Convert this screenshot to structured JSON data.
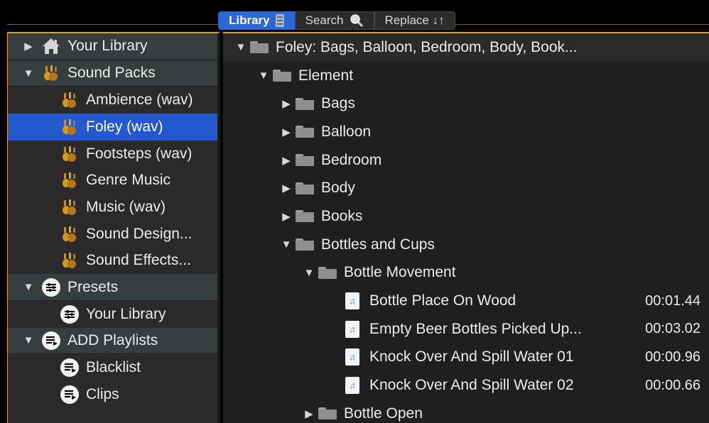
{
  "tabs": {
    "library": "Library",
    "search": "Search",
    "replace": "Replace ↓↑"
  },
  "left": {
    "your_library": "Your Library",
    "sound_packs": "Sound Packs",
    "packs": [
      "Ambience (wav)",
      "Foley (wav)",
      "Footsteps (wav)",
      "Genre Music",
      "Music (wav)",
      "Sound Design...",
      "Sound Effects..."
    ],
    "presets": "Presets",
    "presets_library": "Your Library",
    "add_playlists": "ADD Playlists",
    "playlists": [
      "Blacklist",
      "Clips"
    ]
  },
  "right": {
    "root": "Foley: Bags, Balloon, Bedroom, Body, Book...",
    "element": "Element",
    "folders": [
      "Bags",
      "Balloon",
      "Bedroom",
      "Body",
      "Books"
    ],
    "bottles": "Bottles and Cups",
    "bottle_movement": "Bottle Movement",
    "files": [
      {
        "name": "Bottle Place On Wood",
        "duration": "00:01.44"
      },
      {
        "name": "Empty Beer Bottles Picked Up...",
        "duration": "00:03.02"
      },
      {
        "name": "Knock Over And Spill Water 01",
        "duration": "00:00.96"
      },
      {
        "name": "Knock Over And Spill Water 02",
        "duration": "00:00.66"
      }
    ],
    "bottle_open": "Bottle Open"
  },
  "colors": {
    "accent": "#e0a12a",
    "selection": "#2458d0",
    "tab_active": "#2f66d6"
  }
}
